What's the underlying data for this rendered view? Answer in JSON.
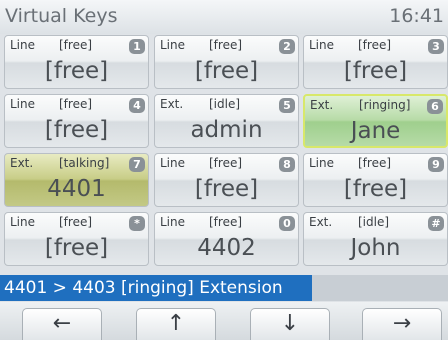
{
  "header": {
    "title": "Virtual Keys",
    "time": "16:41"
  },
  "keys": [
    {
      "type": "Line",
      "state": "[free]",
      "num": "1",
      "main": "[free]"
    },
    {
      "type": "Line",
      "state": "[free]",
      "num": "2",
      "main": "[free]"
    },
    {
      "type": "Line",
      "state": "[free]",
      "num": "3",
      "main": "[free]"
    },
    {
      "type": "Line",
      "state": "[free]",
      "num": "4",
      "main": "[free]"
    },
    {
      "type": "Ext.",
      "state": "[idle]",
      "num": "5",
      "main": "admin"
    },
    {
      "type": "Ext.",
      "state": "[ringing]",
      "num": "6",
      "main": "Jane"
    },
    {
      "type": "Ext.",
      "state": "[talking]",
      "num": "7",
      "main": "4401"
    },
    {
      "type": "Line",
      "state": "[free]",
      "num": "8",
      "main": "[free]"
    },
    {
      "type": "Line",
      "state": "[free]",
      "num": "9",
      "main": "[free]"
    },
    {
      "type": "Line",
      "state": "[free]",
      "num": "*",
      "main": "[free]"
    },
    {
      "type": "Line",
      "state": "[free]",
      "num": "0",
      "main": "4402"
    },
    {
      "type": "Ext.",
      "state": "[idle]",
      "num": "#",
      "main": "John"
    }
  ],
  "status": {
    "text": "4401 > 4403 [ringing] Extension"
  },
  "nav": {
    "left": "←",
    "up": "↑",
    "down": "↓",
    "right": "→"
  },
  "colors": {
    "ringing": "#a8d596",
    "talking": "#bcc278",
    "status_bar": "#1f6fbf"
  }
}
